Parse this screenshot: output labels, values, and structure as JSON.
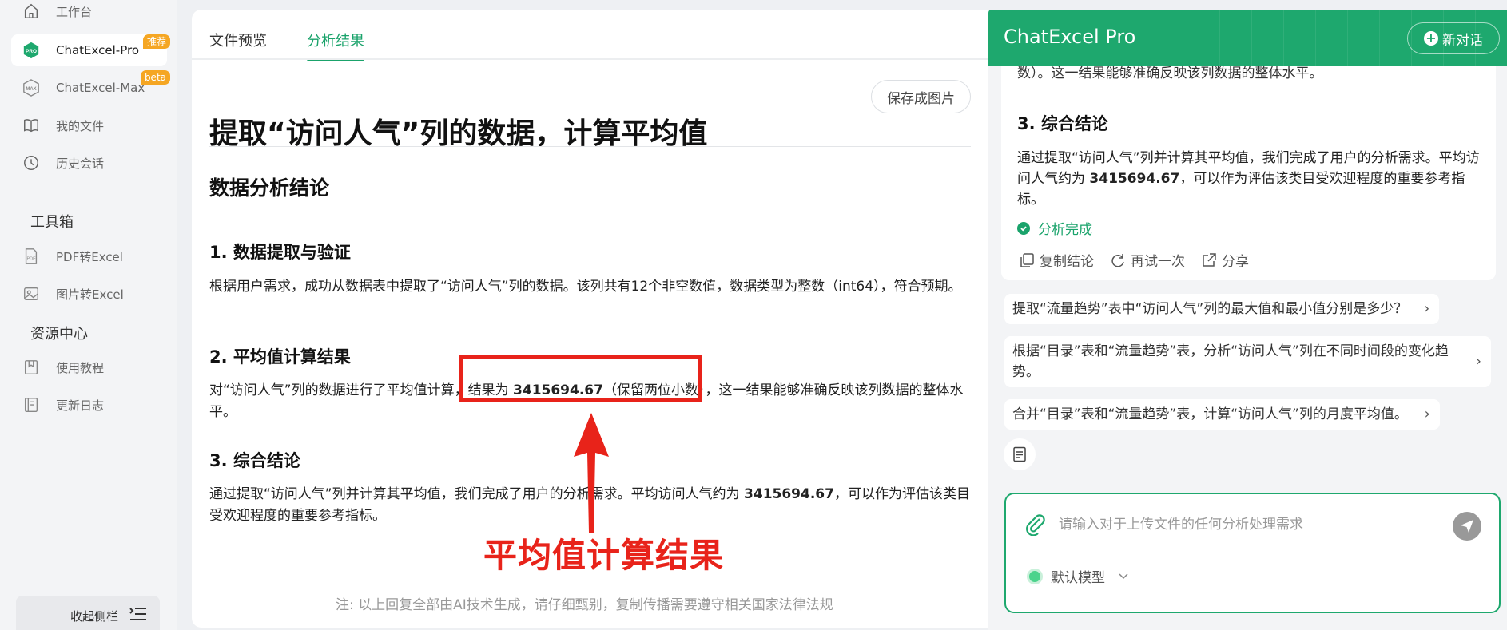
{
  "sidebar": {
    "items": [
      {
        "label": "工作台",
        "icon": "home-icon"
      },
      {
        "label": "ChatExcel-Pro",
        "icon": "pro-icon",
        "badge": "推荐"
      },
      {
        "label": "ChatExcel-Max",
        "icon": "max-icon",
        "badge": "beta"
      },
      {
        "label": "我的文件",
        "icon": "book-icon"
      },
      {
        "label": "历史会话",
        "icon": "clock-icon"
      }
    ],
    "toolbox_title": "工具箱",
    "tools": [
      {
        "label": "PDF转Excel",
        "icon": "pdf-icon"
      },
      {
        "label": "图片转Excel",
        "icon": "image-icon"
      }
    ],
    "resources_title": "资源中心",
    "resources": [
      {
        "label": "使用教程",
        "icon": "tutorial-icon"
      },
      {
        "label": "更新日志",
        "icon": "changelog-icon"
      }
    ],
    "collapse_label": "收起侧栏"
  },
  "main": {
    "tabs": [
      {
        "label": "文件预览"
      },
      {
        "label": "分析结果"
      }
    ],
    "active_tab": "分析结果",
    "save_button": "保存成图片",
    "title": "提取“访问人气”列的数据，计算平均值",
    "section_title": "数据分析结论",
    "s1_heading": "1. 数据提取与验证",
    "s1_text": "根据用户需求，成功从数据表中提取了“访问人气”列的数据。该列共有12个非空数值，数据类型为整数（int64），符合预期。",
    "s2_heading": "2. 平均值计算结果",
    "s2_text_a": "对“访问人气”列的数据进行了平均值计算，结果为 ",
    "s2_value": "3415694.67",
    "s2_text_b": "（保留两位小数），这一结果能够准确反映该列数据的整体水平。",
    "s3_heading": "3. 综合结论",
    "s3_text_a": "通过提取“访问人气”列并计算其平均值，我们完成了用户的分析需求。平均访问人气约为 ",
    "s3_value": "3415694.67",
    "s3_text_b": "，可以作为评估该类目受欢迎程度的重要参考指标。",
    "annotation": "平均值计算结果",
    "footer_note": "注: 以上回复全部由AI技术生成，请仔细甄别，复制传播需要遵守相关国家法律法规"
  },
  "chat": {
    "title": "ChatExcel Pro",
    "new_chat": "新对话",
    "cut_text": "数）。这一结果能够准确反映该列数据的整体水平。",
    "heading": "3. 综合结论",
    "text_a": "通过提取“访问人气”列并计算其平均值，我们完成了用户的分析需求。平均访问人气约为 ",
    "value": "3415694.67",
    "text_b": "，可以作为评估该类目受欢迎程度的重要参考指标。",
    "status": "分析完成",
    "actions": [
      {
        "label": "复制结论"
      },
      {
        "label": "再试一次"
      },
      {
        "label": "分享"
      }
    ],
    "suggestions": [
      {
        "label": "提取“流量趋势”表中“访问人气”列的最大值和最小值分别是多少？"
      },
      {
        "label": "根据“目录”表和“流量趋势”表，分析“访问人气”列在不同时间段的变化趋势。"
      },
      {
        "label": "合并“目录”表和“流量趋势”表，计算“访问人气”列的月度平均值。"
      }
    ],
    "input_placeholder": "请输入对于上传文件的任何分析处理需求",
    "model_label": "默认模型"
  },
  "colors": {
    "accent": "#1ea86e",
    "annotation_red": "#e8231a",
    "badge_orange": "#f5a623"
  }
}
